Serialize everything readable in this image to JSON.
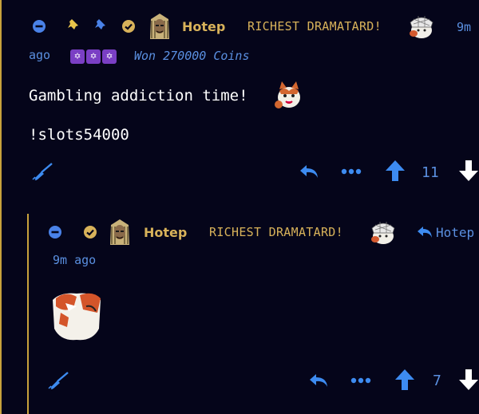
{
  "comment1": {
    "username": "Hotep",
    "flair": "RICHEST DRAMATARD!",
    "time_part1": "9m",
    "time_part2": "ago",
    "badge_icons": [
      "star-of-david-icon",
      "star-of-david-icon",
      "star-of-david-icon"
    ],
    "coins_text": "Won 270000 Coins",
    "body_line1": "Gambling addiction time!",
    "body_line2": "!slots54000",
    "vote_count": "11",
    "colors": {
      "accent": "#3d8bf0",
      "gold": "#d8b25a",
      "badge": "#7a3fc4"
    }
  },
  "comment2": {
    "username": "Hotep",
    "flair": "RICHEST DRAMATARD!",
    "reply_to": "Hotep",
    "time": "9m ago",
    "vote_count": "7"
  }
}
